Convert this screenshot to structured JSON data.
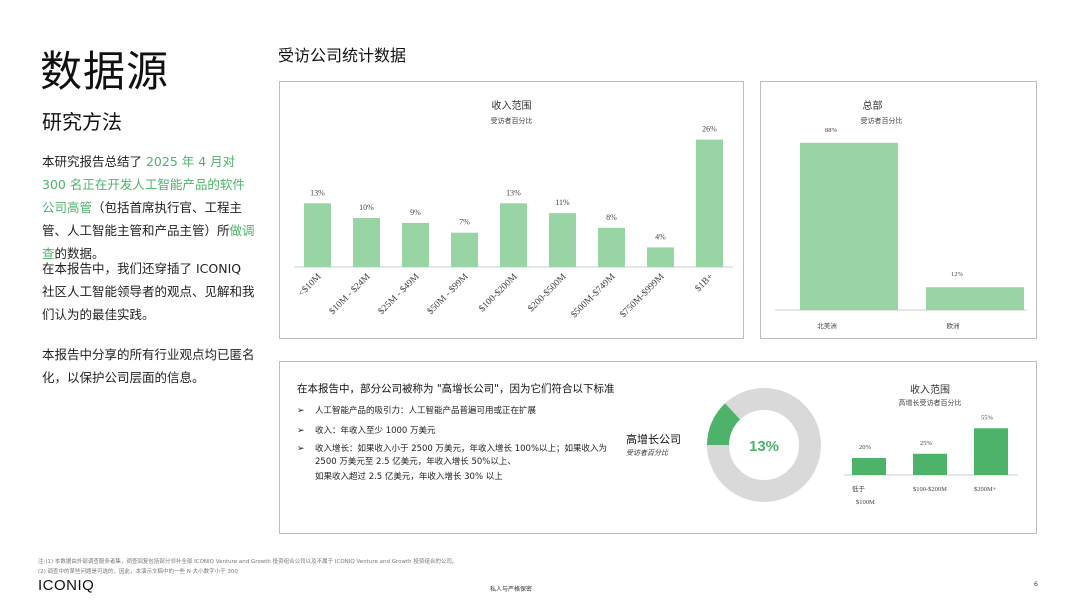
{
  "page": {
    "title": "数据源",
    "subtitle": "研究方法",
    "section_title": "受访公司统计数据",
    "para1": {
      "pre": "本研究报告总结了 ",
      "highlight1": "2025 年 4 月对 300 名正在开发人工智能产品的软件公司高管",
      "mid": "（包括首席执行官、工程主管、人工智能主管和产品主管）所",
      "highlight2": "做调查",
      "post": "的数据。"
    },
    "para2": "在本报告中，我们还穿插了 ICONIQ 社区人工智能领导者的观点、见解和我们认为的最佳实践。",
    "para3": "本报告中分享的所有行业观点均已匿名化，以保护公司层面的信息。",
    "criteria_title": "在本报告中，部分公司被称为 \"高增长公司\"，因为它们符合以下标准",
    "criteria": [
      "人工智能产品的吸引力：人工智能产品普遍可用或正在扩展",
      "收入：年收入至少 1000 万美元",
      "收入增长：如果收入小于 2500 万美元，年收入增长 100%以上；如果收入为 2500 万美元至 2.5 亿美元，年收入增长 50%以上、"
    ],
    "criteria_extra": "如果收入超过 2.5 亿美元，年收入增长 30% 以上",
    "high_growth_label": "高增长公司",
    "high_growth_sub": "受访者百分比",
    "footnote1": "注:(1) 本数据由外部调查服务者集，调查回复包括部分邻补全部 ICONIQ Venture and Growth 投资组合公司以及不属于 ICONIQ Venture and Growth 投资组合的公司。",
    "footnote2": "(2) 调查中的某些问题是可选的，因此，本演示文稿中的一些 N 大小数字小于 300",
    "logo": "ICONIQ",
    "confidential": "私人与严格保密",
    "page_number": "6"
  },
  "colors": {
    "bar_light": "#99d5a4",
    "bar_dark": "#4db36b",
    "donut_rest": "#d9d9d9",
    "highlight_text": "#4db36b"
  },
  "chart_data": [
    {
      "type": "bar",
      "title": "收入范围",
      "subtitle": "受访者百分比",
      "categories": [
        "<$10M",
        "$10M - $24M",
        "$25M - $49M",
        "$50M - $99M",
        "$100-$200M",
        "$200-$500M",
        "$500M-$749M",
        "$750M-$999M",
        "$1B+"
      ],
      "values": [
        13,
        10,
        9,
        7,
        13,
        11,
        8,
        4,
        26
      ],
      "labels": [
        "13%",
        "10%",
        "9%",
        "7%",
        "13%",
        "11%",
        "8%",
        "4%",
        "26%"
      ]
    },
    {
      "type": "bar",
      "title": "总部",
      "subtitle": "受访者百分比",
      "categories": [
        "北美洲",
        "欧洲"
      ],
      "values": [
        88,
        12
      ],
      "labels": [
        "88%",
        "12%"
      ]
    },
    {
      "type": "pie",
      "variant": "donut",
      "values": [
        13,
        87
      ],
      "center_label": "13%"
    },
    {
      "type": "bar",
      "title": "收入范围",
      "subtitle": "高增长受访者百分比",
      "categories": [
        "低于\n$100M",
        "$100-$200M",
        "$200M+"
      ],
      "values": [
        20,
        25,
        55
      ],
      "labels": [
        "20%",
        "25%",
        "55%"
      ]
    }
  ]
}
